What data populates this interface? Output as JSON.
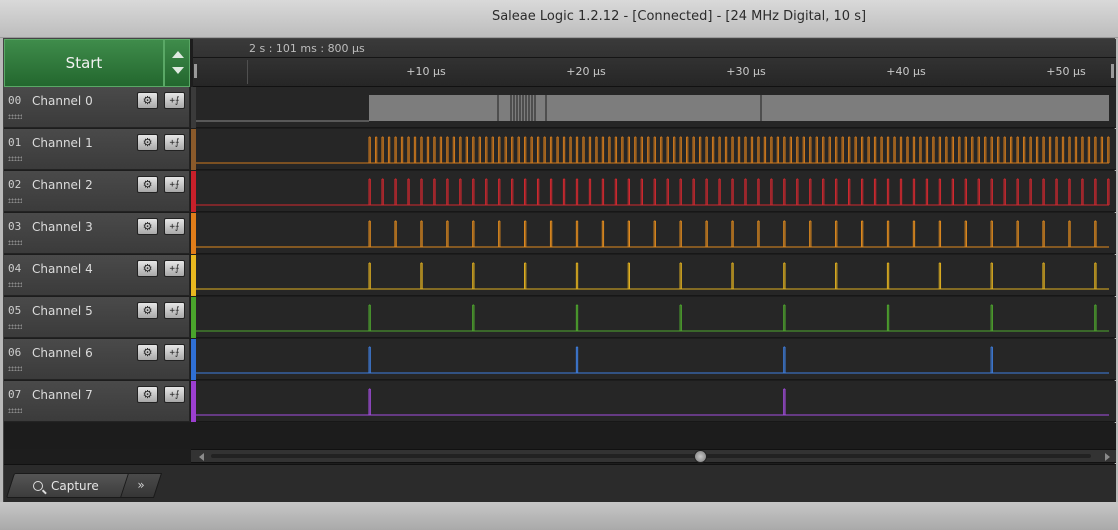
{
  "window": {
    "title": "Saleae Logic 1.2.12 - [Connected] - [24 MHz Digital, 10 s]"
  },
  "controls": {
    "start_label": "Start"
  },
  "timeline": {
    "timestamp": "2 s : 101 ms : 800 µs",
    "ticks": [
      "+10 µs",
      "+20 µs",
      "+30 µs",
      "+40 µs",
      "+50 µs"
    ]
  },
  "channels": [
    {
      "num": "00",
      "name": "Channel 0",
      "color": "#3a3a3a",
      "wave": "#8a8a8a"
    },
    {
      "num": "01",
      "name": "Channel 1",
      "color": "#8a5a2b",
      "wave": "#d07a1d"
    },
    {
      "num": "02",
      "name": "Channel 2",
      "color": "#c8202a",
      "wave": "#d2282f"
    },
    {
      "num": "03",
      "name": "Channel 3",
      "color": "#e07d1a",
      "wave": "#e08a1e"
    },
    {
      "num": "04",
      "name": "Channel 4",
      "color": "#e8b81f",
      "wave": "#e0b020"
    },
    {
      "num": "05",
      "name": "Channel 5",
      "color": "#4aa52c",
      "wave": "#4fa82e"
    },
    {
      "num": "06",
      "name": "Channel 6",
      "color": "#2f6fd4",
      "wave": "#3f7fe0"
    },
    {
      "num": "07",
      "name": "Channel 7",
      "color": "#9c3fd0",
      "wave": "#a44de0"
    }
  ],
  "tabs": {
    "capture_label": "Capture",
    "more_label": "»"
  },
  "icons": {
    "gear": "gear-icon",
    "trigger": "trigger-icon",
    "search": "search-icon"
  }
}
